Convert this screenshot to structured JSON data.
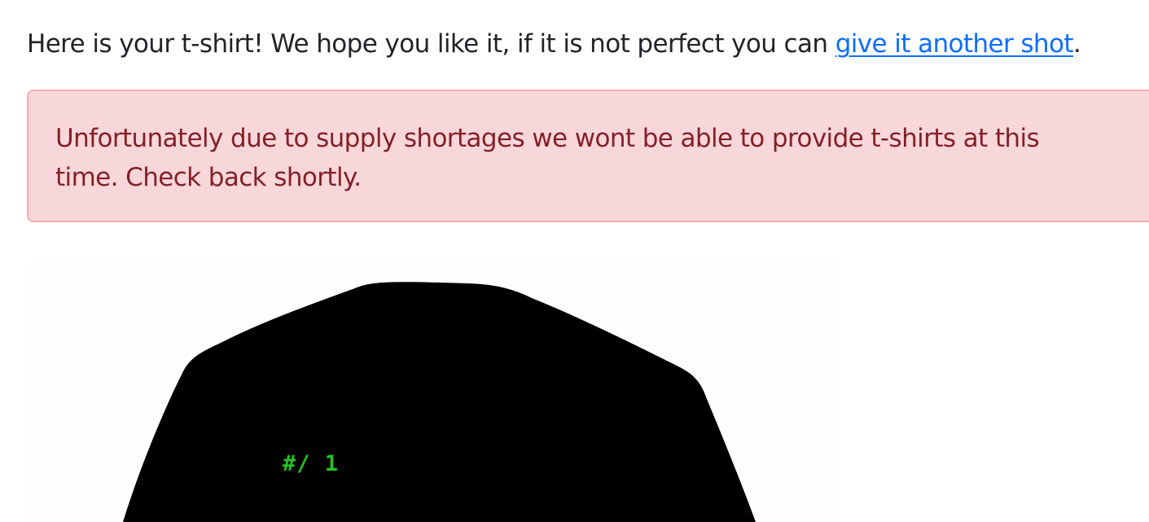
{
  "intro": {
    "text_before": "Here is your t-shirt! We hope you like it, if it is not perfect you can ",
    "link_text": "give it another shot",
    "text_after": "."
  },
  "alert": {
    "message": "Unfortunately due to supply shortages we wont be able to provide t-shirts at this time. Check back shortly."
  },
  "tshirt": {
    "print_text": "#/ 1",
    "shirt_color": "#000000",
    "print_color": "#24c224"
  },
  "colors": {
    "link": "#0d6efd",
    "alert_background": "#f8d7da",
    "alert_border": "#f1aeb5",
    "alert_text": "#842029"
  }
}
